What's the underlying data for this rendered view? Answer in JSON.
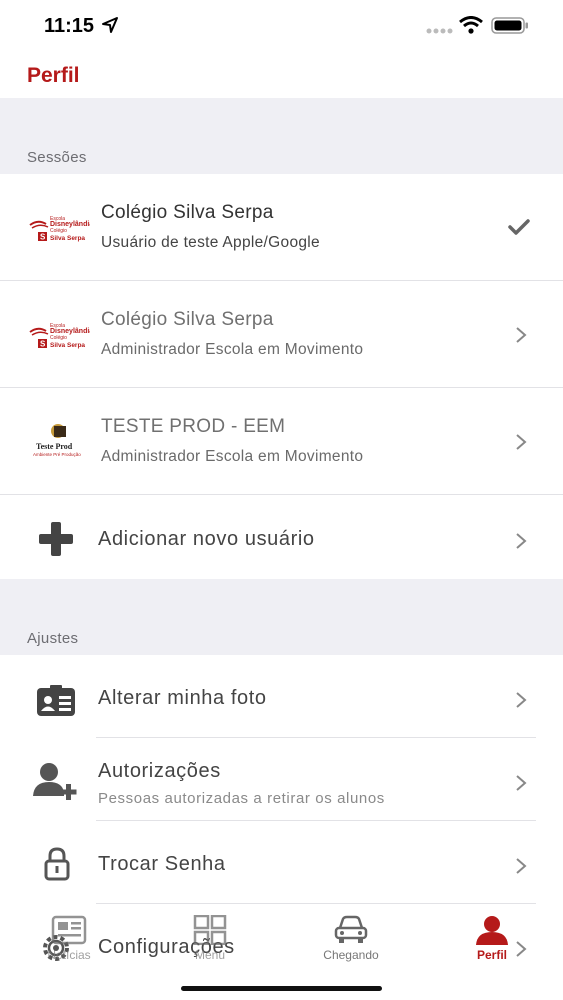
{
  "status": {
    "time": "11:15"
  },
  "header": {
    "title": "Perfil"
  },
  "sessions": {
    "section_title": "Sessões",
    "items": [
      {
        "title": "Colégio Silva Serpa",
        "subtitle": "Usuário de teste Apple/Google",
        "logo": "disneylandia-silva-serpa-logo",
        "active": true
      },
      {
        "title": "Colégio Silva Serpa",
        "subtitle": "Administrador Escola em Movimento",
        "logo": "disneylandia-silva-serpa-logo",
        "active": false
      },
      {
        "title": "TESTE PROD - EEM",
        "subtitle": "Administrador Escola em Movimento",
        "logo": "teste-prod-logo",
        "active": false
      }
    ],
    "add_user_label": "Adicionar novo usuário"
  },
  "settings": {
    "section_title": "Ajustes",
    "items": [
      {
        "label": "Alterar minha foto",
        "icon": "id-card-icon"
      },
      {
        "label": "Autorizações",
        "subtitle": "Pessoas autorizadas a retirar os alunos",
        "icon": "add-person-icon"
      },
      {
        "label": "Trocar Senha",
        "icon": "lock-icon"
      },
      {
        "label": "Configurações",
        "icon": "gear-icon"
      }
    ]
  },
  "tabbar": {
    "items": [
      {
        "label": "Notícias",
        "icon": "news-icon"
      },
      {
        "label": "Menu",
        "icon": "grid-icon"
      },
      {
        "label": "Chegando",
        "icon": "car-icon"
      },
      {
        "label": "Perfil",
        "icon": "person-icon",
        "active": true
      }
    ]
  },
  "colors": {
    "accent": "#b51a1a",
    "section_bg": "#efeff4"
  }
}
